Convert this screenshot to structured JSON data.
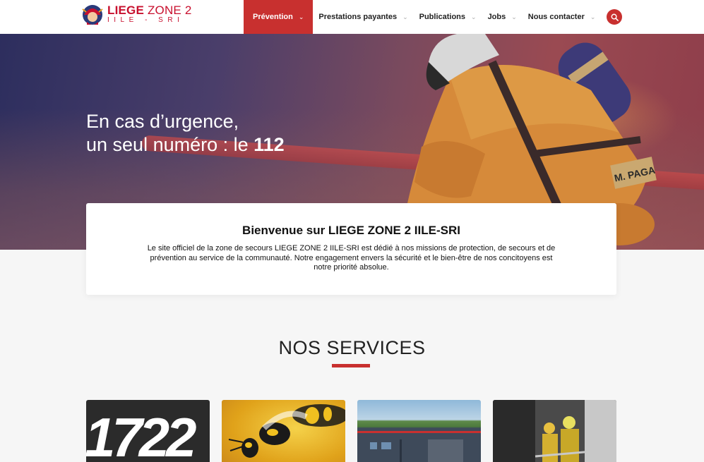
{
  "header": {
    "logo": {
      "line1_bold": "LIEGE",
      "line1_rest": " ZONE 2",
      "line2": "IILE - SRI"
    },
    "nav": [
      {
        "label": "Prévention",
        "active": true
      },
      {
        "label": "Prestations payantes",
        "active": false
      },
      {
        "label": "Publications",
        "active": false
      },
      {
        "label": "Jobs",
        "active": false
      },
      {
        "label": "Nous contacter",
        "active": false
      }
    ],
    "search_icon": "search-icon"
  },
  "hero": {
    "line1": "En cas d’urgence,",
    "line2_prefix": "un seul numéro : le ",
    "line2_number": "112",
    "badge_text": "M. PAGA"
  },
  "welcome": {
    "title": "Bienvenue sur LIEGE ZONE 2 IILE-SRI",
    "text": "Le site officiel de la zone de secours LIEGE ZONE 2 IILE-SRI est dédié à nos missions de protection, de secours et de prévention au service de la communauté. Notre engagement envers la sécurité et le bien-être de nos concitoyens est notre priorité absolue."
  },
  "services": {
    "title": "NOS SERVICES",
    "tiles": [
      {
        "text": "1722"
      },
      {
        "text": ""
      },
      {
        "text": ""
      },
      {
        "text": ""
      }
    ]
  },
  "colors": {
    "accent": "#c8302f",
    "brand": "#c8102e"
  }
}
